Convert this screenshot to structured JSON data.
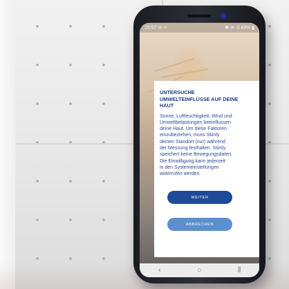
{
  "status_bar": {
    "time": "15:57",
    "left_icons": "⊖ ✕",
    "right_icons": "✱ ≋ .ıl 49% ▮"
  },
  "dialog": {
    "title_line1": "UNTERSUCHE",
    "title_line2": "UMWELTEINFLÜSSE AUF DEINE",
    "title_line3": "HAUT",
    "body_lines": [
      "Sonne, Luftfeuchtigkeit, Wind und",
      "Umweltbelastungen beeinflussen",
      "deine Haut. Um diese Faktoren",
      "einzubeziehen, muss Skinly",
      "deinen Standort (nur) während",
      "der Messung festhalten. Skinly",
      "speichert keine Bewegungsdaten.",
      "Die Einwilligung kann jederzeit",
      "in den Systemeinstellungen",
      "widerrufen werden."
    ],
    "primary_button": "WEITER",
    "secondary_button": "ABBRECHEN"
  },
  "nav_bar": {
    "back": "‹",
    "home": "○",
    "recents": "⦀"
  },
  "colors": {
    "title": "#1f3c86",
    "body_text": "#2b4a92",
    "primary_button": "#1f4a9a",
    "secondary_button": "#5b8fd0"
  }
}
